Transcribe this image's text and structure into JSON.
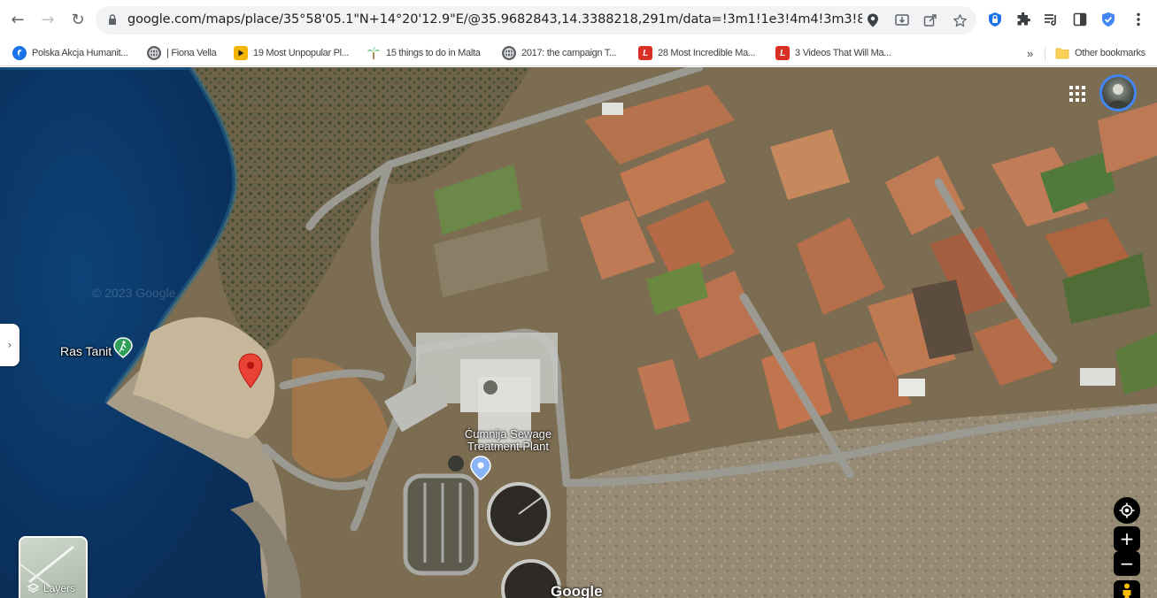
{
  "browser": {
    "url": "google.com/maps/place/35°58'05.1\"N+14°20'12.9\"E/@35.9682843,14.3388218,291m/data=!3m1!1e3!4m4!3m3!8m2!3d35.968...",
    "nav": {
      "back_icon": "arrow-left-icon",
      "forward_icon": "arrow-right-icon",
      "reload_icon": "reload-icon"
    },
    "omnibox_icons": [
      "location-pin-icon",
      "install-icon",
      "share-icon",
      "star-icon"
    ],
    "extension_icons": [
      "lastpass-icon",
      "extensions-puzzle-icon",
      "reading-list-icon",
      "side-panel-icon",
      "shield-check-icon",
      "more-vert-icon"
    ]
  },
  "bookmarks": {
    "items": [
      {
        "label": "Polska Akcja Humanit...",
        "icon": "pah-icon",
        "color": "#1a73e8"
      },
      {
        "label": "| Fiona Vella",
        "icon": "globe-icon",
        "color": "#5f6368"
      },
      {
        "label": "19 Most Unpopular Pl...",
        "icon": "youtube-play-icon",
        "color": "#f4b400"
      },
      {
        "label": "15 things to do in Malta",
        "icon": "palm-icon",
        "color": "#34a853"
      },
      {
        "label": "2017: the campaign T...",
        "icon": "globe-icon",
        "color": "#5f6368"
      },
      {
        "label": "28 Most Incredible Ma...",
        "icon": "lovin-icon",
        "color": "#d93025"
      },
      {
        "label": "3 Videos That Will Ma...",
        "icon": "lovin-icon",
        "color": "#d93025"
      }
    ],
    "overflow": "»",
    "other_bookmarks": "Other bookmarks"
  },
  "map": {
    "labels": {
      "ras_tanit": "Ras Tanit",
      "treatment_plant": "Ċumnija Sewage Treatment Plant",
      "watermark": "© 2023 Google",
      "google_logo": "Google"
    },
    "layers_button": {
      "label": "Layers"
    },
    "controls": {
      "zoom_in": "+",
      "zoom_out": "−"
    },
    "colors": {
      "sea": "#0f3c6b",
      "pin": "#ea4335",
      "hiking_marker": "#2f9e58",
      "poi_marker": "#8ab4f8"
    }
  }
}
